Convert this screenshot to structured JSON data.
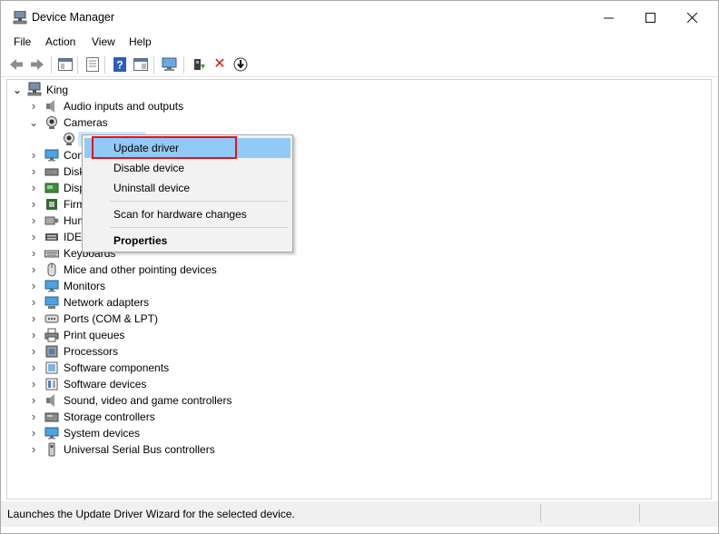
{
  "window": {
    "title": "Device Manager",
    "controls": {
      "minimize": "—",
      "maximize": "☐",
      "close": "✕"
    }
  },
  "menu": [
    "File",
    "Action",
    "View",
    "Help"
  ],
  "toolbar": {
    "buttons": [
      "back-icon",
      "forward-icon",
      "show-hide-console-tree-icon",
      "properties-icon",
      "help-icon",
      "action-pane-icon",
      "scan-hardware-icon",
      "update-driver-icon",
      "uninstall-icon",
      "disable-icon"
    ],
    "uninstall_glyph": "✕"
  },
  "tree": {
    "root": {
      "label": "King",
      "chevron": "⌄"
    },
    "items": [
      {
        "label": "Audio inputs and outputs",
        "chevron": "›",
        "icon": "speaker-icon"
      },
      {
        "label": "Cameras",
        "chevron": "⌄",
        "icon": "camera-icon"
      },
      {
        "label": "",
        "chevron": "",
        "icon": "webcam-icon",
        "child": true
      },
      {
        "label": "Con",
        "chevron": "›",
        "icon": "monitor-icon"
      },
      {
        "label": "Disk",
        "chevron": "›",
        "icon": "disk-icon"
      },
      {
        "label": "Disp",
        "chevron": "›",
        "icon": "display-adapter-icon"
      },
      {
        "label": "Firm",
        "chevron": "›",
        "icon": "firmware-icon"
      },
      {
        "label": "Hum",
        "chevron": "›",
        "icon": "hid-icon"
      },
      {
        "label": "IDE",
        "chevron": "›",
        "icon": "ide-icon"
      },
      {
        "label": "Keyboards",
        "chevron": "›",
        "icon": "keyboard-icon"
      },
      {
        "label": "Mice and other pointing devices",
        "chevron": "›",
        "icon": "mouse-icon"
      },
      {
        "label": "Monitors",
        "chevron": "›",
        "icon": "monitor-icon"
      },
      {
        "label": "Network adapters",
        "chevron": "›",
        "icon": "network-icon"
      },
      {
        "label": "Ports (COM & LPT)",
        "chevron": "›",
        "icon": "port-icon"
      },
      {
        "label": "Print queues",
        "chevron": "›",
        "icon": "printer-icon"
      },
      {
        "label": "Processors",
        "chevron": "›",
        "icon": "processor-icon"
      },
      {
        "label": "Software components",
        "chevron": "›",
        "icon": "software-component-icon"
      },
      {
        "label": "Software devices",
        "chevron": "›",
        "icon": "software-device-icon"
      },
      {
        "label": "Sound, video and game controllers",
        "chevron": "›",
        "icon": "speaker-icon"
      },
      {
        "label": "Storage controllers",
        "chevron": "›",
        "icon": "storage-icon"
      },
      {
        "label": "System devices",
        "chevron": "›",
        "icon": "system-icon"
      },
      {
        "label": "Universal Serial Bus controllers",
        "chevron": "›",
        "icon": "usb-icon"
      }
    ]
  },
  "context_menu": {
    "update_driver": "Update driver",
    "disable_device": "Disable device",
    "uninstall_device": "Uninstall device",
    "scan": "Scan for hardware changes",
    "properties": "Properties",
    "highlight_color": "#91c9f7",
    "annotation_color": "#e8101c"
  },
  "status": {
    "text": "Launches the Update Driver Wizard for the selected device."
  }
}
